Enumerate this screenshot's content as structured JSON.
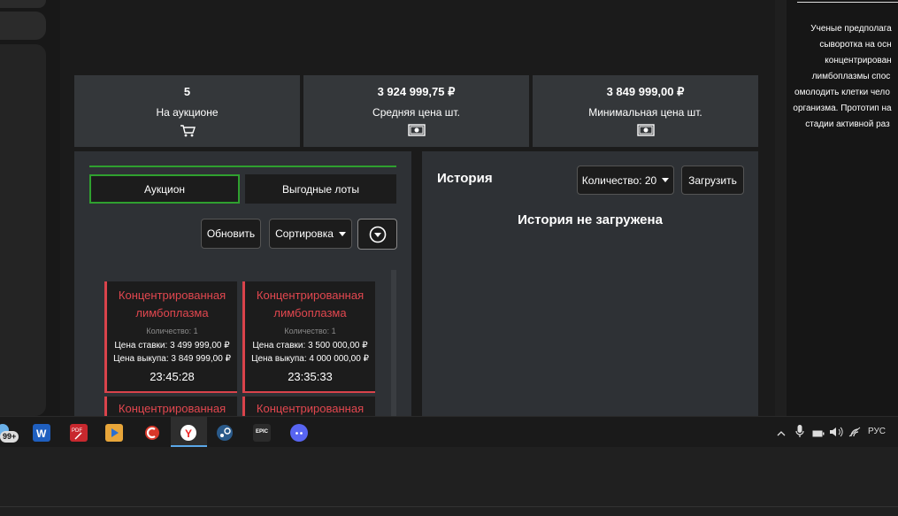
{
  "stats": [
    {
      "value": "5",
      "label": "На аукционе",
      "icon": "cart-icon"
    },
    {
      "value": "3 924 999,75 ₽",
      "label": "Средняя цена шт.",
      "icon": "cash-icon"
    },
    {
      "value": "3 849 999,00 ₽",
      "label": "Минимальная цена шт.",
      "icon": "cash-icon"
    }
  ],
  "auction": {
    "tabs": [
      "Аукцион",
      "Выгодные лоты"
    ],
    "refresh_label": "Обновить",
    "sort_label": "Сортировка",
    "cards": [
      {
        "name_line1": "Концентрированная",
        "name_line2": "лимбоплазма",
        "qty": "Количество: 1",
        "bid": "Цена ставки: 3 499 999,00 ₽",
        "buyout": "Цена выкупа: 3 849 999,00 ₽",
        "time": "23:45:28"
      },
      {
        "name_line1": "Концентрированная",
        "name_line2": "лимбоплазма",
        "qty": "Количество: 1",
        "bid": "Цена ставки: 3 500 000,00 ₽",
        "buyout": "Цена выкупа: 4 000 000,00 ₽",
        "time": "23:35:33"
      },
      {
        "name_line1": "Концентрированная"
      },
      {
        "name_line1": "Концентрированная"
      }
    ]
  },
  "history": {
    "title": "История",
    "count_label": "Количество: 20",
    "load_label": "Загрузить",
    "empty_text": "История не загружена"
  },
  "right_panel": {
    "lines": [
      "Ученые предполага",
      "сыворотка на осн",
      "концентрирован",
      "лимбоплазмы спос",
      "омолодить клетки чело",
      "организма. Прототип на",
      "стадии активной раз"
    ]
  },
  "taskbar": {
    "badge": "99+",
    "lang": "РУС",
    "apps": [
      "word-icon",
      "pdf-icon",
      "media-player-icon",
      "ccleaner-icon",
      "yandex-browser-icon",
      "steam-icon",
      "epic-games-icon",
      "discord-icon"
    ]
  }
}
